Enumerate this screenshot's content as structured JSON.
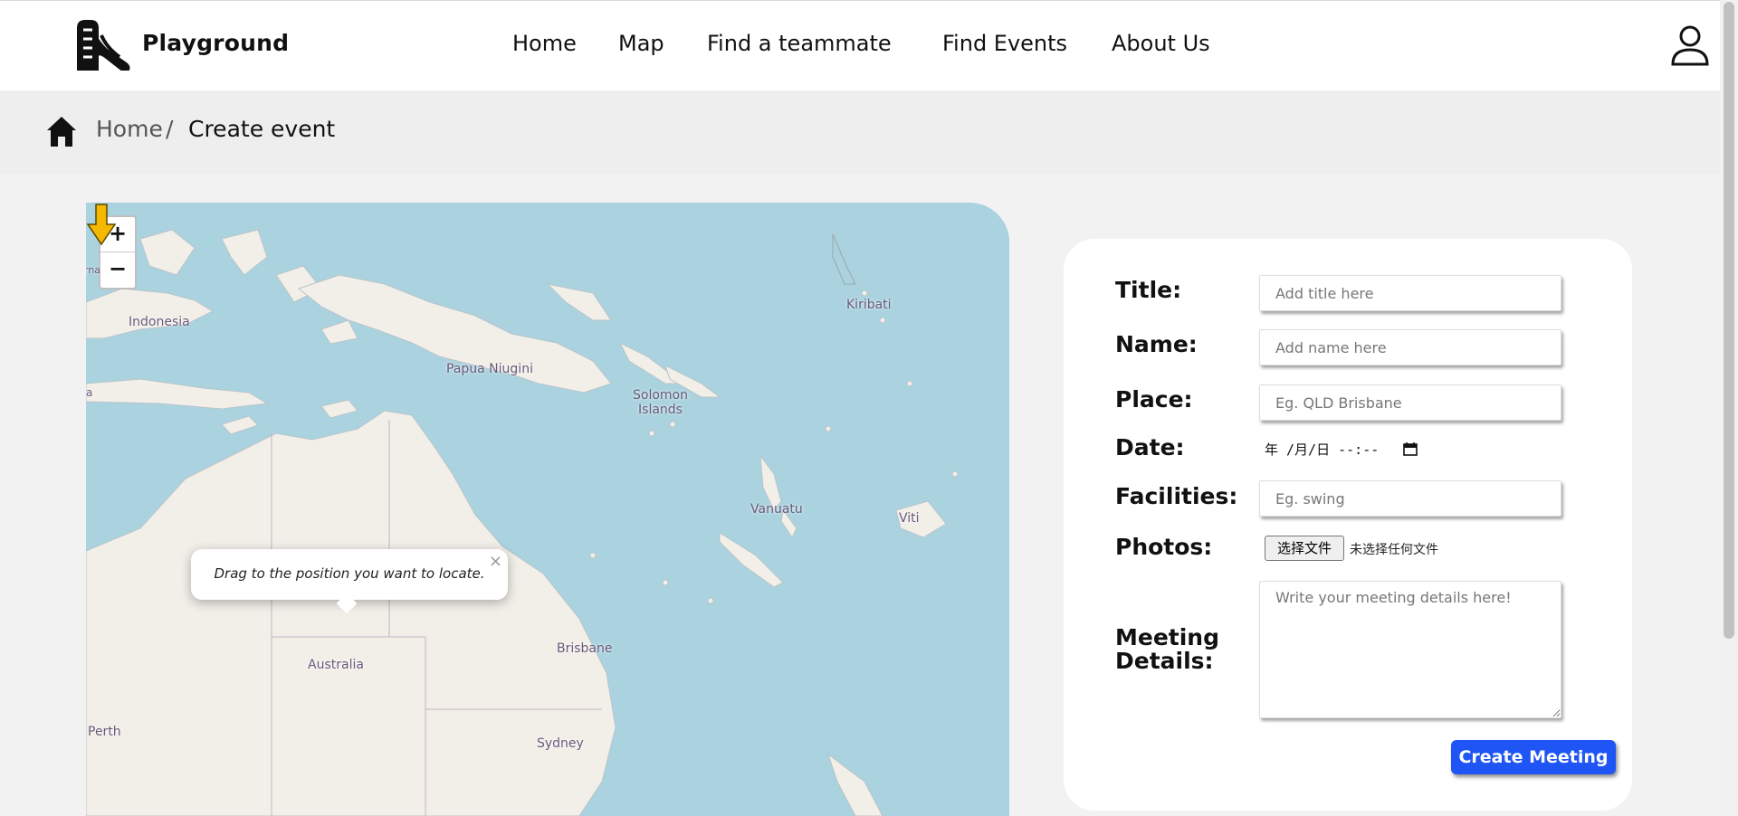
{
  "header": {
    "brand": "Playground",
    "nav": [
      {
        "label": "Home"
      },
      {
        "label": "Map"
      },
      {
        "label": "Find a teammate"
      },
      {
        "label": "Find Events"
      },
      {
        "label": "About Us"
      }
    ]
  },
  "breadcrumb": {
    "home": "Home",
    "separator": "/",
    "current": "Create event"
  },
  "map": {
    "zoom_in": "+",
    "zoom_out": "−",
    "labels": {
      "indonesia": "Indonesia",
      "papua": "Papua Niugini",
      "solomon": "Solomon\nIslands",
      "kiribati": "Kiribati",
      "vanuatu": "Vanuatu",
      "fiji": "Viti",
      "australia": "Australia",
      "brisbane": "Brisbane",
      "sydney": "Sydney",
      "perth": "Perth",
      "edge_left_1": "rna",
      "edge_left_2": "a"
    },
    "popup": {
      "text": "Drag to the position you want to locate.",
      "close": "×"
    },
    "colors": {
      "sea": "#aad3df",
      "land": "#f2efe9",
      "marker": "#f5b800"
    }
  },
  "form": {
    "title_label": "Title:",
    "title_placeholder": "Add title here",
    "name_label": "Name:",
    "name_placeholder": "Add name here",
    "place_label": "Place:",
    "place_placeholder": "Eg. QLD Brisbane",
    "date_label": "Date:",
    "date_value": "年 /月/日 --:--",
    "facilities_label": "Facilities:",
    "facilities_placeholder": "Eg. swing",
    "photos_label": "Photos:",
    "file_button": "选择文件",
    "file_status": "未选择任何文件",
    "details_label_1": "Meeting",
    "details_label_2": "Details:",
    "details_placeholder": "Write your meeting details here!",
    "submit": "Create Meeting",
    "colors": {
      "submit": "#1f55f5"
    }
  }
}
